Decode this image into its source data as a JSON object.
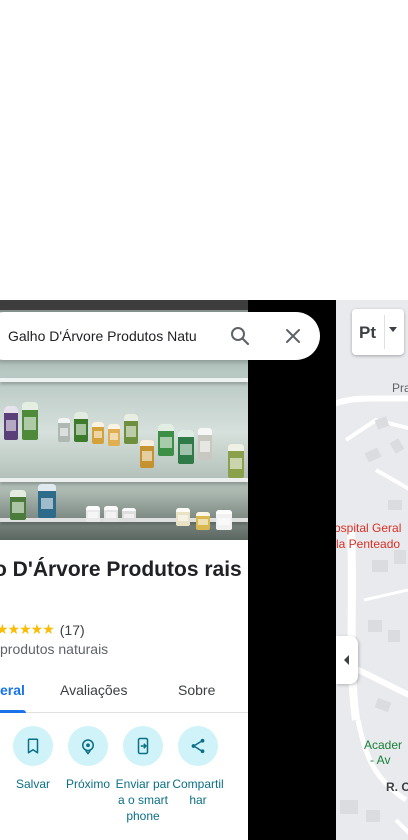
{
  "search": {
    "value": "Galho D'Árvore Produtos Natu",
    "search_icon": "search-icon",
    "close_icon": "close-icon"
  },
  "place": {
    "title": "o D'Árvore Produtos rais",
    "stars": "★★★★★",
    "review_count": "(17)",
    "category": "produtos naturais"
  },
  "tabs": [
    {
      "label": "eral",
      "active": true
    },
    {
      "label": "Avaliações",
      "active": false
    },
    {
      "label": "Sobre",
      "active": false
    }
  ],
  "actions": [
    {
      "label": "Salvar",
      "icon": "bookmark-icon"
    },
    {
      "label": "Próximo",
      "icon": "nearby-icon"
    },
    {
      "label": "Enviar para o smartphone",
      "icon": "send-to-phone-icon"
    },
    {
      "label": "Compartilhar",
      "icon": "share-icon"
    }
  ],
  "map": {
    "labels": {
      "pra": "Pra",
      "hospital_line1": "ospital Geral",
      "hospital_line2": "la Penteado",
      "academia_line1": "Acader",
      "academia_line2": "- Av",
      "street": "R. C"
    },
    "language_button": "Pt"
  },
  "colors": {
    "accent": "#1a73e8",
    "action_circle": "#cff3f8",
    "action_text": "#0b6f86",
    "star": "#fbbc04",
    "hospital": "#d93025"
  }
}
